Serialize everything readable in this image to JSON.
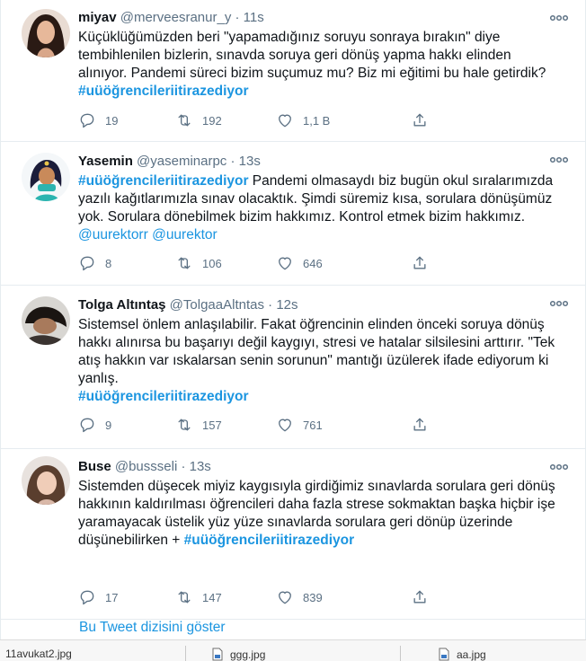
{
  "tweets": [
    {
      "name": "miyav",
      "handle": "@merveesranur_y",
      "time": "11s",
      "text": "Küçüklüğümüzden beri \"yapamadığınız soruyu sonraya bırakın\" diye tembihlenilen bizlerin, sınavda soruya geri dönüş yapma hakkı elinden alınıyor. Pandemi süreci bizim suçumuz mu? Biz mi eğitimi bu hale getirdik?",
      "hashtag": "#uüöğrencileriitirazediyor",
      "replies": "19",
      "retweets": "192",
      "likes": "1,1 B"
    },
    {
      "name": "Yasemin",
      "handle": "@yaseminarpc",
      "time": "13s",
      "hashtag": "#uüöğrencileriitirazediyor",
      "text": " Pandemi olmasaydı biz bugün okul sıralarımızda yazılı kağıtlarımızla sınav olacaktık. Şimdi süremiz kısa, sorulara dönüşümüz yok. Sorulara dönebilmek bizim hakkımız. Kontrol etmek bizim hakkımız.",
      "mention1": "@uurektorr",
      "mention2": "@uurektor",
      "replies": "8",
      "retweets": "106",
      "likes": "646"
    },
    {
      "name": "Tolga Altıntaş",
      "handle": "@TolgaaAltntas",
      "time": "12s",
      "text": "Sistemsel önlem anlaşılabilir. Fakat öğrencinin elinden önceki soruya dönüş hakkı alınırsa bu başarıyı değil kaygıyı, stresi ve hatalar silsilesini arttırır. \"Tek atış hakkın var ıskalarsan senin sorunun\" mantığı üzülerek ifade ediyorum ki yanlış.",
      "hashtag": "#uüöğrencileriitirazediyor",
      "replies": "9",
      "retweets": "157",
      "likes": "761"
    },
    {
      "name": "Buse",
      "handle": "@bussseli",
      "time": "13s",
      "text": "Sistemden düşecek miyiz kaygısıyla girdiğimiz sınavlarda sorulara geri dönüş hakkının kaldırılması öğrencileri daha fazla  strese sokmaktan başka hiçbir işe yaramayacak üstelik yüz yüze sınavlarda sorulara geri dönüp üzerinde düşünebilirken + ",
      "hashtag": "#uüöğrencileriitirazediyor",
      "replies": "17",
      "retweets": "147",
      "likes": "839"
    }
  ],
  "show_thread": "Bu Tweet dizisini göster",
  "downloads": [
    {
      "name": "11avukat2.jpg"
    },
    {
      "name": "ggg.jpg"
    },
    {
      "name": "aa.jpg"
    }
  ],
  "colors": {
    "accent": "#1b95e0",
    "muted": "#5b7083",
    "divider": "#e6ecf0"
  },
  "icons": [
    "reply-icon",
    "retweet-icon",
    "like-icon",
    "share-icon",
    "more-icon",
    "file-icon"
  ]
}
